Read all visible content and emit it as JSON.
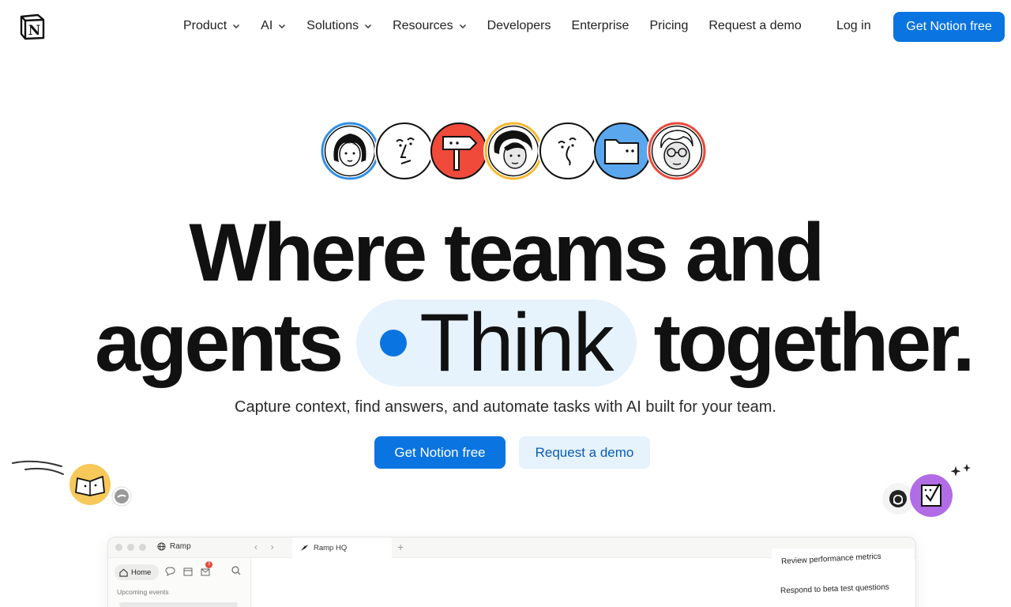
{
  "nav": {
    "logo_letter": "N",
    "items": [
      {
        "label": "Product",
        "has_dropdown": true
      },
      {
        "label": "AI",
        "has_dropdown": true
      },
      {
        "label": "Solutions",
        "has_dropdown": true
      },
      {
        "label": "Resources",
        "has_dropdown": true
      },
      {
        "label": "Developers",
        "has_dropdown": false
      },
      {
        "label": "Enterprise",
        "has_dropdown": false
      },
      {
        "label": "Pricing",
        "has_dropdown": false
      },
      {
        "label": "Request a demo",
        "has_dropdown": false
      }
    ],
    "login_label": "Log in",
    "cta_label": "Get Notion free"
  },
  "avatars": [
    {
      "name": "woman-avatar-icon",
      "ring": "#2f8fe6"
    },
    {
      "name": "face-sketch-icon",
      "ring": "#111111"
    },
    {
      "name": "signpost-avatar-icon",
      "ring": "#111111",
      "fill": "#ef4a3a"
    },
    {
      "name": "curly-hair-avatar-icon",
      "ring": "#f5b82e"
    },
    {
      "name": "thinking-face-icon",
      "ring": "#111111"
    },
    {
      "name": "folder-avatar-icon",
      "ring": "#111111",
      "fill": "#5aa7ee"
    },
    {
      "name": "glasses-man-avatar-icon",
      "ring": "#e8493a"
    }
  ],
  "hero": {
    "line1": "Where teams and",
    "line2_start": "agents",
    "highlight": "Think",
    "line2_end": "together.",
    "subtitle": "Capture context, find answers, and automate tasks with AI built for your team.",
    "cta_primary": "Get Notion free",
    "cta_secondary": "Request a demo"
  },
  "app": {
    "workspace": "Ramp",
    "tab_title": "Ramp HQ",
    "home_label": "Home",
    "notification_count": "3",
    "section_label": "Upcoming events",
    "tasks": [
      "Review performance metrics",
      "Respond to beta test questions"
    ]
  },
  "colors": {
    "accent": "#0a74e0",
    "accent_soft": "#e6f2fc"
  }
}
